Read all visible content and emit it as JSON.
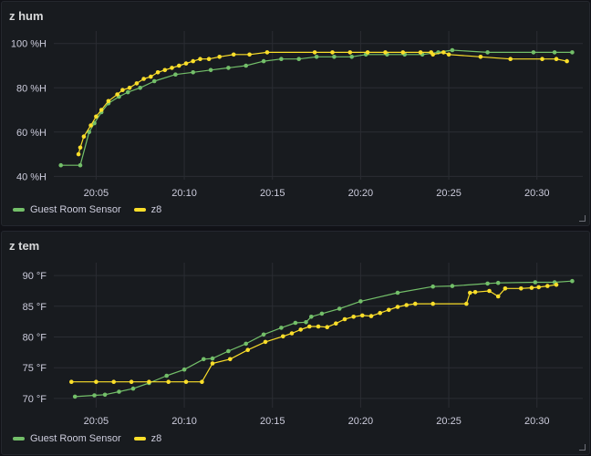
{
  "panels": [
    {
      "title": "z hum",
      "legend": [
        "Guest Room Sensor",
        "z8"
      ]
    },
    {
      "title": "z tem",
      "legend": [
        "Guest Room Sensor",
        "z8"
      ]
    }
  ],
  "colors": {
    "series_green": "#73bf69",
    "series_yellow": "#fade2a",
    "grid": "#2a2d33",
    "text": "#ccccdc"
  },
  "chart_data": [
    {
      "type": "line",
      "title": "z hum",
      "x_unit": "minutes past 20:00",
      "xlim": [
        2.6,
        32.6
      ],
      "x_ticks": [
        5,
        10,
        15,
        20,
        25,
        30
      ],
      "x_tick_labels": [
        "20:05",
        "20:10",
        "20:15",
        "20:20",
        "20:25",
        "20:30"
      ],
      "ylim": [
        38.5,
        104
      ],
      "y_ticks": [
        40,
        60,
        80,
        100
      ],
      "y_tick_labels": [
        "40 %H",
        "60 %H",
        "80 %H",
        "100 %H"
      ],
      "grid": true,
      "legend_position": "bottom-left",
      "series": [
        {
          "name": "Guest Room Sensor",
          "color": "#73bf69",
          "x": [
            3.0,
            4.1,
            4.6,
            4.9,
            5.3,
            5.7,
            6.3,
            6.8,
            7.5,
            8.3,
            9.5,
            10.5,
            11.5,
            12.5,
            13.5,
            14.5,
            15.5,
            16.5,
            17.5,
            18.5,
            19.5,
            20.3,
            21.5,
            22.5,
            23.5,
            24.4,
            25.2,
            27.2,
            29.8,
            31.0,
            32.0
          ],
          "y": [
            45,
            45,
            60,
            64,
            69,
            73,
            76,
            78,
            80,
            83,
            86,
            87,
            88,
            89,
            90,
            92,
            93,
            93,
            94,
            94,
            94,
            95,
            95,
            95,
            95,
            96,
            97,
            96,
            96,
            96,
            96
          ]
        },
        {
          "name": "z8",
          "color": "#fade2a",
          "x": [
            4.0,
            4.1,
            4.3,
            4.7,
            5.0,
            5.3,
            5.7,
            6.2,
            6.5,
            6.9,
            7.3,
            7.7,
            8.1,
            8.5,
            8.9,
            9.3,
            9.7,
            10.1,
            10.5,
            10.9,
            11.4,
            12.0,
            12.8,
            13.7,
            14.7,
            17.4,
            18.4,
            19.4,
            20.4,
            21.4,
            22.4,
            23.4,
            24.0,
            24.1,
            24.7,
            25.0,
            26.8,
            28.5,
            30.3,
            31.1,
            31.7
          ],
          "y": [
            50,
            53,
            58,
            63,
            67,
            70,
            74,
            77,
            79,
            80,
            82,
            84,
            85,
            87,
            88,
            89,
            90,
            91,
            92,
            93,
            93,
            94,
            95,
            95,
            96,
            96,
            96,
            96,
            96,
            96,
            96,
            96,
            96,
            95,
            96,
            95,
            94,
            93,
            93,
            93,
            92
          ]
        }
      ]
    },
    {
      "type": "line",
      "title": "z tem",
      "x_unit": "minutes past 20:00",
      "xlim": [
        2.6,
        32.6
      ],
      "x_ticks": [
        5,
        10,
        15,
        20,
        25,
        30
      ],
      "x_tick_labels": [
        "20:05",
        "20:10",
        "20:15",
        "20:20",
        "20:25",
        "20:30"
      ],
      "ylim": [
        68.5,
        91.5
      ],
      "y_ticks": [
        70,
        75,
        80,
        85,
        90
      ],
      "y_tick_labels": [
        "70 °F",
        "75 °F",
        "80 °F",
        "85 °F",
        "90 °F"
      ],
      "grid": true,
      "legend_position": "bottom-left",
      "series": [
        {
          "name": "Guest Room Sensor",
          "color": "#73bf69",
          "x": [
            3.8,
            4.9,
            5.5,
            6.3,
            7.1,
            8.0,
            9.0,
            10.0,
            11.1,
            11.6,
            12.5,
            13.5,
            14.5,
            15.5,
            16.3,
            16.9,
            17.2,
            17.8,
            18.8,
            20.0,
            22.1,
            24.1,
            25.2,
            27.2,
            27.8,
            29.9,
            31.0,
            32.0
          ],
          "y": [
            70.3,
            70.5,
            70.6,
            71.1,
            71.6,
            72.5,
            73.7,
            74.7,
            76.4,
            76.5,
            77.7,
            78.9,
            80.4,
            81.5,
            82.3,
            82.4,
            83.3,
            83.8,
            84.6,
            85.8,
            87.2,
            88.2,
            88.3,
            88.7,
            88.8,
            88.9,
            88.9,
            89.1
          ]
        },
        {
          "name": "z8",
          "color": "#fade2a",
          "x": [
            3.6,
            5.0,
            6.0,
            7.0,
            8.0,
            9.1,
            10.1,
            11.0,
            11.6,
            12.6,
            13.6,
            14.6,
            15.6,
            16.1,
            16.6,
            17.1,
            17.6,
            18.1,
            18.6,
            19.1,
            19.6,
            20.1,
            20.6,
            21.1,
            21.6,
            22.1,
            22.6,
            23.1,
            24.1,
            26.0,
            26.2,
            26.5,
            27.3,
            27.8,
            28.2,
            29.1,
            29.7,
            30.1,
            30.6,
            31.1
          ],
          "y": [
            72.7,
            72.7,
            72.7,
            72.7,
            72.7,
            72.7,
            72.7,
            72.7,
            75.7,
            76.4,
            77.9,
            79.2,
            80.1,
            80.6,
            81.2,
            81.7,
            81.7,
            81.6,
            82.2,
            82.9,
            83.3,
            83.5,
            83.4,
            83.9,
            84.4,
            84.9,
            85.2,
            85.4,
            85.4,
            85.4,
            87.2,
            87.3,
            87.5,
            86.6,
            87.9,
            87.9,
            88.0,
            88.1,
            88.3,
            88.5
          ]
        }
      ]
    }
  ]
}
